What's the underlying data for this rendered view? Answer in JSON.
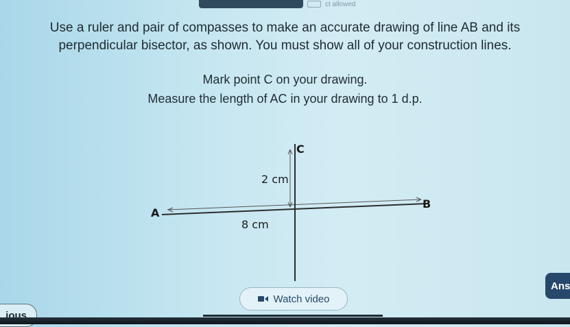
{
  "status": {
    "label": "ct allowed"
  },
  "question": {
    "line1": "Use a ruler and pair of compasses to make an accurate drawing of line AB and its",
    "line2": "perpendicular bisector, as shown. You must show all of your construction lines.",
    "mark": "Mark point C on your drawing.",
    "measure": "Measure the length of AC in your drawing to 1 d.p."
  },
  "diagram": {
    "label_a": "A",
    "label_b": "B",
    "label_c": "C",
    "len_ab": "8 cm",
    "len_c": "2 cm"
  },
  "buttons": {
    "watch_video": "Watch video",
    "answer": "Ans",
    "previous": "ious"
  },
  "colors": {
    "navy": "#27486a",
    "background": "#c5e6f1"
  }
}
